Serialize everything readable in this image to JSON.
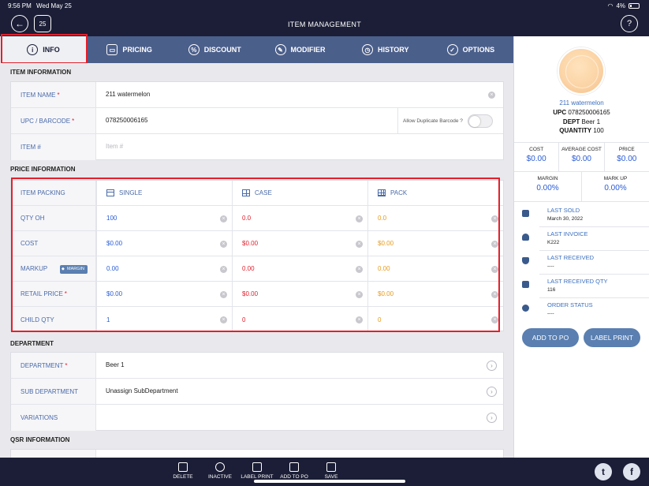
{
  "status_bar": {
    "time": "9:56 PM",
    "date": "Wed May 25",
    "battery": "4%"
  },
  "header": {
    "title": "ITEM MANAGEMENT",
    "calendar_day": "25",
    "help": "?"
  },
  "tabs": [
    {
      "label": "INFO",
      "icon": "info-icon"
    },
    {
      "label": "PRICING",
      "icon": "pricing-icon"
    },
    {
      "label": "DISCOUNT",
      "icon": "discount-icon"
    },
    {
      "label": "MODIFIER",
      "icon": "modifier-icon"
    },
    {
      "label": "HISTORY",
      "icon": "history-icon"
    },
    {
      "label": "OPTIONS",
      "icon": "options-icon"
    }
  ],
  "item_information": {
    "title": "ITEM INFORMATION",
    "item_name_label": "ITEM NAME",
    "item_name_value": "211 watermelon",
    "upc_label": "UPC / BARCODE",
    "upc_value": "078250006165",
    "allow_duplicate_label": "Allow Duplicate Barcode ?",
    "item_no_label": "ITEM #",
    "item_no_placeholder": "Item #"
  },
  "price_information": {
    "title": "PRICE INFORMATION",
    "headers": {
      "packing": "ITEM PACKING",
      "single": "SINGLE",
      "case": "CASE",
      "pack": "PACK"
    },
    "margin_tag": "MARGIN",
    "rows": [
      {
        "label": "QTY OH",
        "required": false,
        "single": "100",
        "case": "0.0",
        "pack": "0.0"
      },
      {
        "label": "COST",
        "required": false,
        "single": "$0.00",
        "case": "$0.00",
        "pack": "$0.00"
      },
      {
        "label": "MARKUP",
        "required": false,
        "single": "0.00",
        "case": "0.00",
        "pack": "0.00"
      },
      {
        "label": "RETAIL PRICE",
        "required": true,
        "single": "$0.00",
        "case": "$0.00",
        "pack": "$0.00"
      },
      {
        "label": "CHILD QTY",
        "required": false,
        "single": "1",
        "case": "0",
        "pack": "0"
      }
    ]
  },
  "department": {
    "title": "DEPARTMENT",
    "department_label": "DEPARTMENT",
    "department_value": "Beer 1",
    "sub_department_label": "SUB DEPARTMENT",
    "sub_department_value": "Unassign SubDepartment",
    "variations_label": "VARIATIONS"
  },
  "qsr": {
    "title": "QSR INFORMATION"
  },
  "summary": {
    "name": "211 watermelon",
    "upc_label": "UPC",
    "upc_value": "078250006165",
    "dept_label": "DEPT",
    "dept_value": "Beer 1",
    "qty_label": "QUANTITY",
    "qty_value": "100",
    "cost_label": "COST",
    "cost_value": "$0.00",
    "avg_cost_label": "AVERAGE COST",
    "avg_cost_value": "$0.00",
    "price_label": "PRICE",
    "price_value": "$0.00",
    "margin_label": "MARGIN",
    "margin_value": "0.00%",
    "markup_label": "MARK UP",
    "markup_value": "0.00%",
    "info": [
      {
        "label": "LAST SOLD",
        "value": "March 30, 2022",
        "icon": "bag-icon"
      },
      {
        "label": "LAST INVOICE",
        "value": "K222",
        "icon": "stack-icon"
      },
      {
        "label": "LAST RECEIVED",
        "value": "----",
        "icon": "tray-icon"
      },
      {
        "label": "LAST RECEIVED QTY",
        "value": "116",
        "icon": "box-icon"
      },
      {
        "label": "ORDER STATUS",
        "value": "----",
        "icon": "pie-icon"
      }
    ],
    "add_to_po": "ADD TO PO",
    "label_print": "LABEL PRINT"
  },
  "toolbar": {
    "delete": "DELETE",
    "inactive": "INACTIVE",
    "label_print": "LABEL PRINT",
    "add_to_po": "ADD TO PO",
    "save": "SAVE"
  },
  "colors": {
    "header": "#1b1e36",
    "tabs": "#4b5f8b",
    "label": "#4a6aa8",
    "blue": "#2a5cd6",
    "red": "#e2202c",
    "orange": "#e69a1c",
    "highlight": "#e2202c"
  }
}
